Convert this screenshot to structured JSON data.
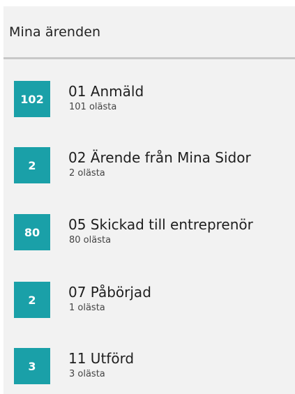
{
  "header": {
    "title": "Mina ärenden"
  },
  "items": [
    {
      "count": "102",
      "title": "01 Anmäld",
      "subtitle": "101 olästa"
    },
    {
      "count": "2",
      "title": "02 Ärende från Mina Sidor",
      "subtitle": "2 olästa"
    },
    {
      "count": "80",
      "title": "05 Skickad till entreprenör",
      "subtitle": "80 olästa"
    },
    {
      "count": "2",
      "title": "07 Påbörjad",
      "subtitle": "1 olästa"
    },
    {
      "count": "3",
      "title": "11 Utförd",
      "subtitle": "3 olästa"
    }
  ],
  "colors": {
    "badge": "#1aa0a8",
    "panel_background": "#f2f2f2",
    "divider": "#c8c8c8"
  }
}
